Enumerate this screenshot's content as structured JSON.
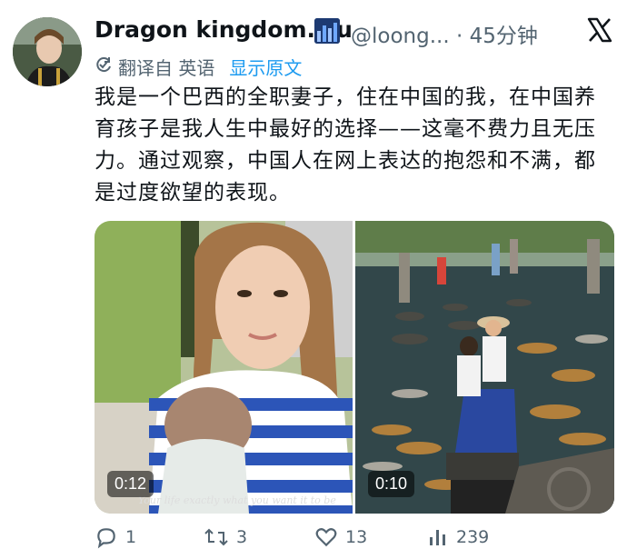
{
  "author": {
    "display_name": "Dragon kingdom.wu",
    "handle": "@loong...",
    "separator": "·",
    "time": "45分钟"
  },
  "translation": {
    "label": "翻译自 英语",
    "show_original": "显示原文"
  },
  "post": {
    "text": "我是一个巴西的全职妻子，住在中国的我，在中国养育孩子是我人生中最好的选择——这毫不费力且无压力。通过观察，中国人在网上表达的抱怨和不满，都是过度欲望的表现。"
  },
  "media": [
    {
      "duration": "0:12",
      "caption": "Your life exactly what you want it to be"
    },
    {
      "duration": "0:10"
    }
  ],
  "actions": {
    "replies": "1",
    "reposts": "3",
    "likes": "13",
    "views": "239"
  },
  "colors": {
    "link": "#1d9bf0",
    "muted": "#536471",
    "text": "#0f1419"
  },
  "icons": [
    "x-logo-icon",
    "translate-icon",
    "reply-icon",
    "repost-icon",
    "like-icon",
    "views-icon",
    "verified-badge-icon"
  ]
}
